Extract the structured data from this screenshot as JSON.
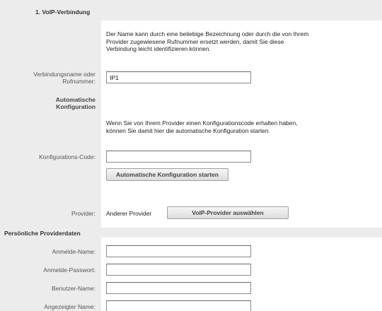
{
  "section1": {
    "title": "1. VoIP-Verbindung",
    "intro": "Der Name kann durch eine beliebige Bezeichnung oder durch die von Ihrem Provider zugewiesene Rufnummer ersetzt werden, damit Sie diese Verbindung leicht identifizieren können.",
    "connection_name_label_line1": "Verbindungsname oder",
    "connection_name_label_line2": "Rufnummer:",
    "connection_name_value": "IP1"
  },
  "auto_config": {
    "heading_line1": "Automatische",
    "heading_line2": "Konfiguration",
    "description": "Wenn Sie von Ihrem Provider einen Konfigurationscode erhalten haben, können Sie damit hier die automatische Konfiguration starten.",
    "code_label": "Konfigurations-Code:",
    "code_value": "",
    "start_button": "Automatische Konfiguration starten"
  },
  "provider": {
    "label": "Provider:",
    "value": "Anderer Provider",
    "select_button": "VoIP-Provider auswählen"
  },
  "personal": {
    "title": "Persönliche Providerdaten",
    "login_name_label": "Anmelde-Name:",
    "login_name_value": "",
    "login_password_label": "Anmelde-Passwort:",
    "login_password_value": "",
    "user_name_label": "Benutzer-Name:",
    "user_name_value": "",
    "display_name_label": "Angezeigter Name:",
    "display_name_value": ""
  }
}
